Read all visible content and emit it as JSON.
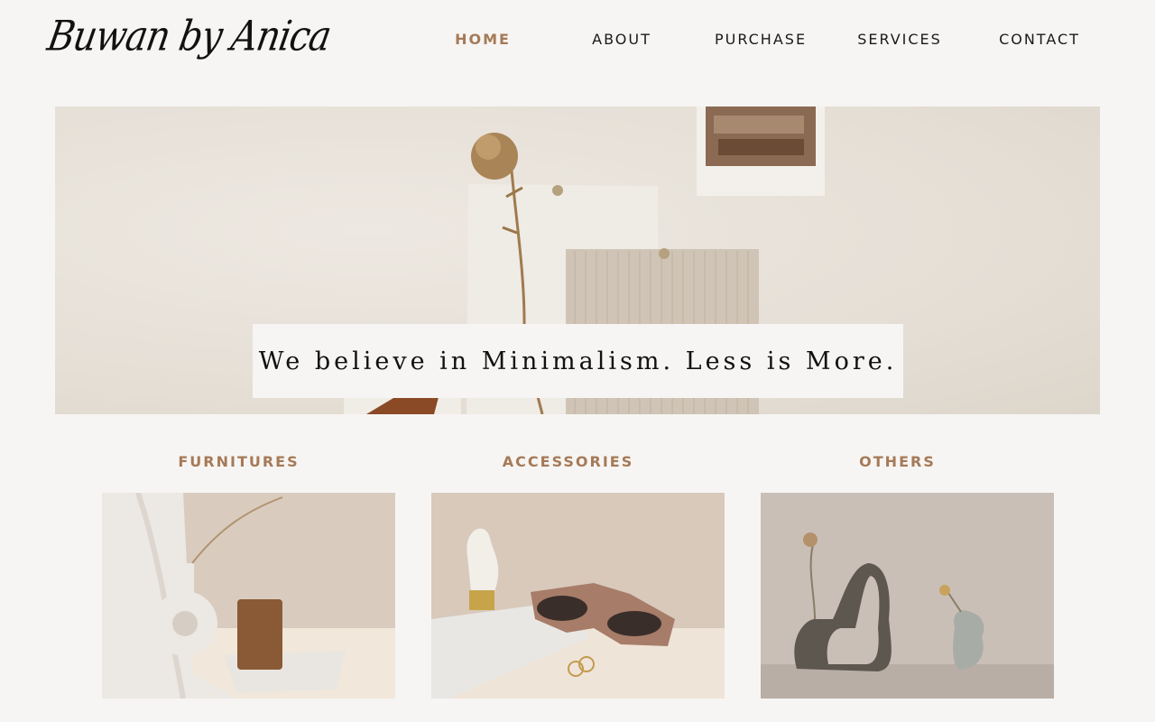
{
  "brand": {
    "logo_text": "Buwan by Anica"
  },
  "nav": {
    "items": [
      {
        "label": "HOME",
        "active": true
      },
      {
        "label": "ABOUT"
      },
      {
        "label": "PURCHASE"
      },
      {
        "label": "SERVICES"
      },
      {
        "label": "CONTACT"
      }
    ]
  },
  "hero": {
    "tagline": "We believe in Minimalism. Less is More.",
    "image": "moodboard-dried-flower-fabric-swatches"
  },
  "categories": [
    {
      "title": "FURNITURES",
      "image": "ring-vase-candle-marble-tray"
    },
    {
      "title": "ACCESSORIES",
      "image": "sunglasses-rings-torso-candle"
    },
    {
      "title": "OTHERS",
      "image": "sculptural-vases-dried-flowers"
    }
  ],
  "colors": {
    "accent": "#a57a58",
    "background": "#f7f5f3",
    "text": "#1a1a1a"
  }
}
